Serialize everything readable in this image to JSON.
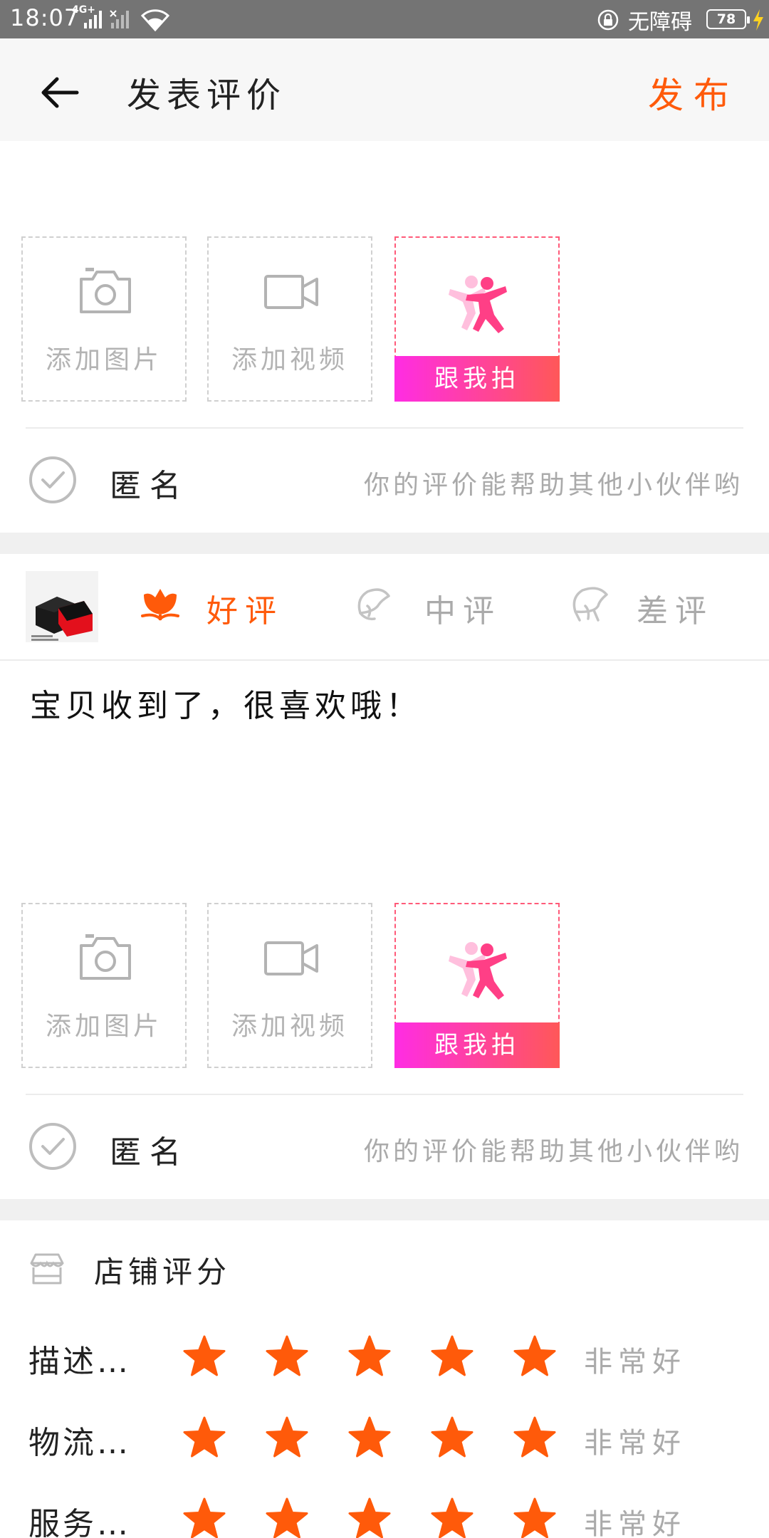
{
  "status_bar": {
    "time": "18:07",
    "network": "4G+",
    "accessibility": "无障碍",
    "battery": "78",
    "icons": [
      "signal-icon",
      "signal-off-icon",
      "wifi-icon",
      "lock-rotation-icon",
      "battery-icon",
      "charging-icon"
    ]
  },
  "header": {
    "back_icon": "arrow-left-icon",
    "title": "发表评价",
    "publish_label": "发布"
  },
  "colors": {
    "accent": "#ff5a0a",
    "star": "#ff5a0a",
    "gradient_start": "#ff2ce4",
    "gradient_end": "#ff5858"
  },
  "media_section_1": {
    "add_photo": "添加图片",
    "add_video": "添加视频",
    "follow_shoot": "跟我拍"
  },
  "anonymous_1": {
    "label": "匿名",
    "hint": "你的评价能帮助其他小伙伴哟"
  },
  "rating_row": {
    "good": "好评",
    "neutral": "中评",
    "bad": "差评",
    "selected": "好评"
  },
  "review": {
    "text": "宝贝收到了，很喜欢哦！"
  },
  "media_section_2": {
    "add_photo": "添加图片",
    "add_video": "添加视频",
    "follow_shoot": "跟我拍"
  },
  "anonymous_2": {
    "label": "匿名",
    "hint": "你的评价能帮助其他小伙伴哟"
  },
  "store_rating": {
    "title": "店铺评分",
    "rows": [
      {
        "label": "描述…",
        "stars": 5,
        "max": 5,
        "word": "非常好"
      },
      {
        "label": "物流…",
        "stars": 5,
        "max": 5,
        "word": "非常好"
      },
      {
        "label": "服务…",
        "stars": 5,
        "max": 5,
        "word": "非常好"
      }
    ]
  }
}
